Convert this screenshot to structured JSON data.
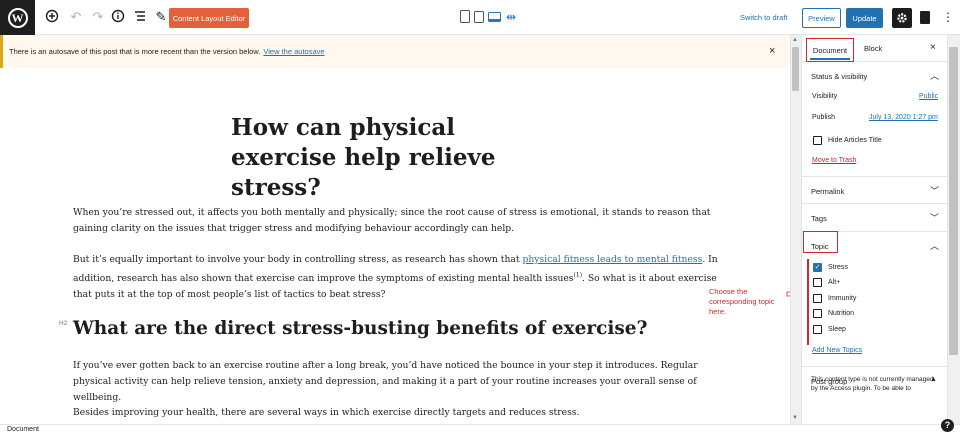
{
  "toolbar": {
    "logo_text": "W",
    "content_layout_editor": "Content Layout Editor",
    "switch_to_draft": "Switch to draft",
    "preview": "Preview",
    "update": "Update",
    "accent": "#2271b1",
    "cle_color": "#e2603a"
  },
  "notice": {
    "text": "There is an autosave of this post that is more recent than the version below.",
    "link": "View the autosave",
    "close": "×"
  },
  "post": {
    "title": "How can physical exercise help relieve stress?",
    "p1": "When you’re stressed out, it affects you both mentally and physically; since the root cause of stress is emotional, it stands to reason that gaining clarity on the issues that trigger stress and modifying behaviour accordingly can help.",
    "p2_before": "But it’s equally important to involve your body in controlling stress, as research has shown that ",
    "p2_link": "physical fitness leads to mental fitness",
    "p2_mid": ". In addition, research has also shown that exercise can improve the symptoms of existing mental health issues",
    "p2_sup": "(1)",
    "p2_after": ". So what is it about exercise that puts it at the top of most people’s list of tactics to beat stress?",
    "h2_label": "H2",
    "h2": "What are the direct stress-busting benefits of exercise?",
    "p3": "If you’ve ever gotten back to an exercise routine after a long break, you’d have noticed the bounce in your step it introduces. Regular physical activity can help relieve tension, anxiety and depression, and making it a part of your routine increases your overall sense of wellbeing.",
    "p4": "Besides improving your health, there are several ways in which exercise directly targets and reduces stress."
  },
  "annotation": {
    "text": "Choose the corresponding topic here.",
    "color": "#d0282c"
  },
  "sidebar": {
    "tab_document": "Document",
    "tab_block": "Block",
    "close": "×",
    "status_visibility": {
      "title": "Status & visibility",
      "visibility_label": "Visibility",
      "visibility_value": "Public",
      "publish_label": "Publish",
      "publish_value": "July 13, 2020 1:27 pm",
      "hide_title_label": "Hide Articles Title",
      "move_to_trash": "Move to Trash"
    },
    "permalink": "Permalink",
    "tags": "Tags",
    "topic": {
      "title": "Topic",
      "items": [
        {
          "label": "Stress",
          "checked": true
        },
        {
          "label": "Alt+",
          "checked": false
        },
        {
          "label": "Immunity",
          "checked": false
        },
        {
          "label": "Nutrition",
          "checked": false
        },
        {
          "label": "Sleep",
          "checked": false
        }
      ],
      "add_new": "Add New Topics"
    },
    "post_group": {
      "title": "Post group",
      "description": "This content type is not currently managed by the Access plugin. To be able to"
    }
  },
  "footer": {
    "breadcrumb": "Document",
    "help": "?"
  }
}
